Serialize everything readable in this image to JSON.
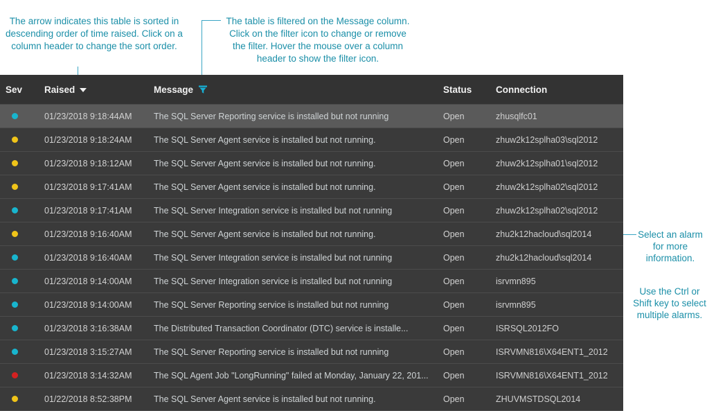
{
  "annotations": {
    "sort": "The arrow indicates this table is sorted in descending order of time raised. Click on a column header to change the sort order.",
    "filter": "The table is filtered on the Message column. Click on the filter icon to change or remove the filter. Hover the mouse over a column header to show the filter icon.",
    "select": "Select an alarm for more information.",
    "multi_select": "Use the Ctrl or Shift key to select multiple alarms.",
    "accent_color": "#1b8fa8"
  },
  "table": {
    "columns": [
      {
        "key": "sev",
        "label": "Sev",
        "icon": null
      },
      {
        "key": "time",
        "label": "Raised",
        "icon": "sort-descending-arrow-icon"
      },
      {
        "key": "msg",
        "label": "Message",
        "icon": "filter-funnel-icon"
      },
      {
        "key": "stat",
        "label": "Status",
        "icon": null
      },
      {
        "key": "conn",
        "label": "Connection",
        "icon": null
      }
    ],
    "sort": {
      "column": "Raised",
      "direction": "descending"
    },
    "filter": {
      "column": "Message"
    },
    "severity_colors": {
      "info": "#18b5ce",
      "warning": "#f0c419",
      "critical": "#d42121"
    },
    "rows": [
      {
        "severity": "info",
        "time": "01/23/2018 9:18:44AM",
        "message": "The SQL Server Reporting service is installed but not running",
        "status": "Open",
        "connection": "zhusqlfc01",
        "selected": true
      },
      {
        "severity": "warning",
        "time": "01/23/2018 9:18:24AM",
        "message": "The SQL Server Agent service is installed but not running.",
        "status": "Open",
        "connection": "zhuw2k12splha03\\sql2012",
        "selected": false
      },
      {
        "severity": "warning",
        "time": "01/23/2018 9:18:12AM",
        "message": "The SQL Server Agent service is installed but not running.",
        "status": "Open",
        "connection": "zhuw2k12splha01\\sql2012",
        "selected": false
      },
      {
        "severity": "warning",
        "time": "01/23/2018 9:17:41AM",
        "message": "The SQL Server Agent service is installed but not running.",
        "status": "Open",
        "connection": "zhuw2k12splha02\\sql2012",
        "selected": false
      },
      {
        "severity": "info",
        "time": "01/23/2018 9:17:41AM",
        "message": "The SQL Server Integration service is installed but not running",
        "status": "Open",
        "connection": "zhuw2k12splha02\\sql2012",
        "selected": false
      },
      {
        "severity": "warning",
        "time": "01/23/2018 9:16:40AM",
        "message": "The SQL Server Agent service is installed but not running.",
        "status": "Open",
        "connection": "zhu2k12hacloud\\sql2014",
        "selected": false
      },
      {
        "severity": "info",
        "time": "01/23/2018 9:16:40AM",
        "message": "The SQL Server Integration service is installed but not running",
        "status": "Open",
        "connection": "zhu2k12hacloud\\sql2014",
        "selected": false
      },
      {
        "severity": "info",
        "time": "01/23/2018 9:14:00AM",
        "message": "The SQL Server Integration service is installed but not running",
        "status": "Open",
        "connection": "isrvmn895",
        "selected": false
      },
      {
        "severity": "info",
        "time": "01/23/2018 9:14:00AM",
        "message": "The SQL Server Reporting service is installed but not running",
        "status": "Open",
        "connection": "isrvmn895",
        "selected": false
      },
      {
        "severity": "info",
        "time": "01/23/2018 3:16:38AM",
        "message": "The Distributed Transaction Coordinator (DTC) service is installe...",
        "status": "Open",
        "connection": "ISRSQL2012FO",
        "selected": false
      },
      {
        "severity": "info",
        "time": "01/23/2018 3:15:27AM",
        "message": "The SQL Server Reporting service is installed but not running",
        "status": "Open",
        "connection": "ISRVMN816\\X64ENT1_2012",
        "selected": false
      },
      {
        "severity": "critical",
        "time": "01/23/2018 3:14:32AM",
        "message": "The SQL Agent Job \"LongRunning\" failed at Monday, January 22, 201...",
        "status": "Open",
        "connection": "ISRVMN816\\X64ENT1_2012",
        "selected": false
      },
      {
        "severity": "warning",
        "time": "01/22/2018 8:52:38PM",
        "message": "The SQL Server Agent service is installed but not running.",
        "status": "Open",
        "connection": "ZHUVMSTDSQL2014",
        "selected": false
      }
    ]
  }
}
